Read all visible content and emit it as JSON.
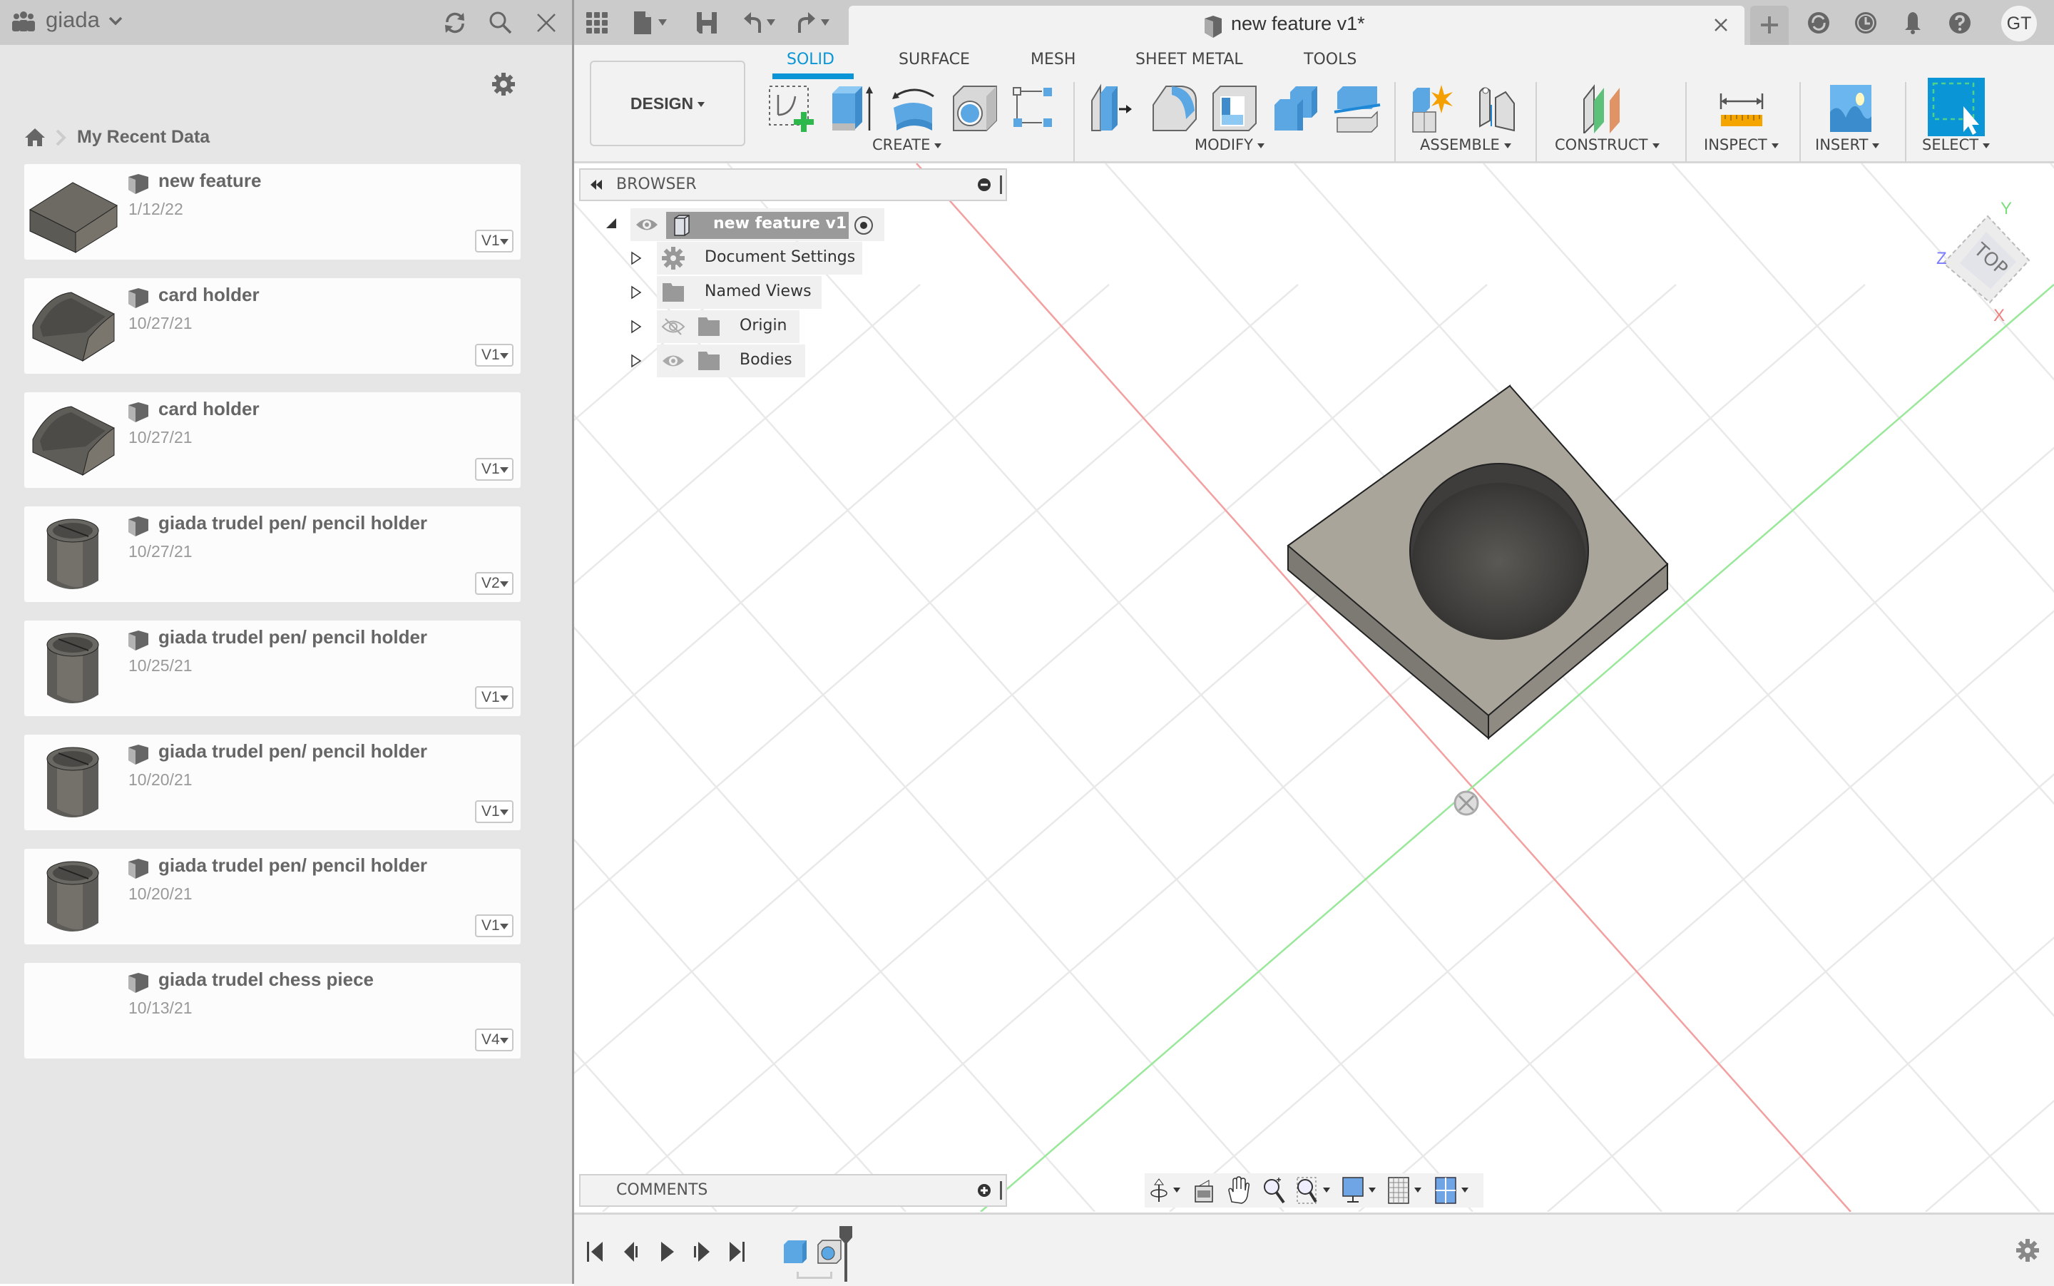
{
  "data_panel": {
    "team_name": "giada",
    "breadcrumb": "My Recent Data",
    "items": [
      {
        "name": "new feature",
        "date": "1/12/22",
        "version": "V1",
        "thumb": "box"
      },
      {
        "name": "card holder",
        "date": "10/27/21",
        "version": "V1",
        "thumb": "cardholder"
      },
      {
        "name": "card holder",
        "date": "10/27/21",
        "version": "V1",
        "thumb": "cardholder"
      },
      {
        "name": "giada trudel pen/ pencil holder",
        "date": "10/27/21",
        "version": "V2",
        "thumb": "cylinder"
      },
      {
        "name": "giada trudel pen/ pencil holder",
        "date": "10/25/21",
        "version": "V1",
        "thumb": "cylinder"
      },
      {
        "name": "giada trudel pen/ pencil holder",
        "date": "10/20/21",
        "version": "V1",
        "thumb": "cylinder"
      },
      {
        "name": "giada trudel pen/ pencil holder",
        "date": "10/20/21",
        "version": "V1",
        "thumb": "cylinder"
      },
      {
        "name": "giada trudel chess piece",
        "date": "10/13/21",
        "version": "V4",
        "thumb": "none"
      }
    ]
  },
  "document_tab": {
    "title": "new feature v1*"
  },
  "user": {
    "initials": "GT"
  },
  "workspace": {
    "label": "DESIGN"
  },
  "ribbon": {
    "tabs": [
      {
        "label": "SOLID",
        "active": true
      },
      {
        "label": "SURFACE",
        "active": false
      },
      {
        "label": "MESH",
        "active": false
      },
      {
        "label": "SHEET METAL",
        "active": false
      },
      {
        "label": "TOOLS",
        "active": false
      }
    ],
    "groups": {
      "create": "CREATE",
      "modify": "MODIFY",
      "assemble": "ASSEMBLE",
      "construct": "CONSTRUCT",
      "inspect": "INSPECT",
      "insert": "INSERT",
      "select": "SELECT"
    }
  },
  "browser": {
    "title": "BROWSER",
    "root": "new feature v1",
    "children": [
      "Document Settings",
      "Named Views",
      "Origin",
      "Bodies"
    ]
  },
  "viewcube": {
    "face": "TOP",
    "axes": {
      "x": "X",
      "y": "Y",
      "z": "Z"
    }
  },
  "comments": {
    "title": "COMMENTS"
  },
  "colors": {
    "accent": "#0a96d6",
    "x_axis": "#f07070",
    "y_axis": "#6ee06e",
    "z_axis": "#6b6bff",
    "body": "#a9a49a"
  }
}
